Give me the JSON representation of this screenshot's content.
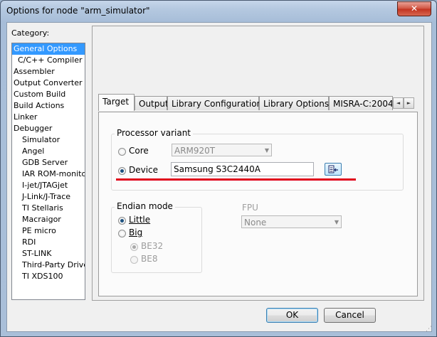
{
  "window": {
    "title": "Options for node \"arm_simulator\"",
    "close_glyph": "✕"
  },
  "category": {
    "label": "Category:",
    "items": [
      {
        "label": "General Options",
        "selected": true,
        "indent": 0
      },
      {
        "label": "C/C++ Compiler",
        "indent": 1
      },
      {
        "label": "Assembler",
        "indent": 0
      },
      {
        "label": "Output Converter",
        "indent": 0
      },
      {
        "label": "Custom Build",
        "indent": 0
      },
      {
        "label": "Build Actions",
        "indent": 0
      },
      {
        "label": "Linker",
        "indent": 0
      },
      {
        "label": "Debugger",
        "indent": 0
      },
      {
        "label": "Simulator",
        "indent": 2
      },
      {
        "label": "Angel",
        "indent": 2
      },
      {
        "label": "GDB Server",
        "indent": 2
      },
      {
        "label": "IAR ROM-monitor",
        "indent": 2
      },
      {
        "label": "I-jet/JTAGjet",
        "indent": 2
      },
      {
        "label": "J-Link/J-Trace",
        "indent": 2
      },
      {
        "label": "TI Stellaris",
        "indent": 2
      },
      {
        "label": "Macraigor",
        "indent": 2
      },
      {
        "label": "PE micro",
        "indent": 2
      },
      {
        "label": "RDI",
        "indent": 2
      },
      {
        "label": "ST-LINK",
        "indent": 2
      },
      {
        "label": "Third-Party Driver",
        "indent": 2
      },
      {
        "label": "TI XDS100",
        "indent": 2
      }
    ]
  },
  "tabs": {
    "items": [
      "Target",
      "Output",
      "Library Configuration",
      "Library Options",
      "MISRA-C:2004"
    ],
    "active": 0,
    "scroll_left": "◄",
    "scroll_right": "►"
  },
  "processor": {
    "group_label": "Processor variant",
    "core_label": "Core",
    "core_value": "ARM920T",
    "device_label": "Device",
    "device_value": "Samsung S3C2440A",
    "selected": "device",
    "highlight_color": "#e0001a"
  },
  "endian": {
    "group_label": "Endian mode",
    "little_label": "Little",
    "big_label": "Big",
    "be32_label": "BE32",
    "be8_label": "BE8",
    "selected": "little"
  },
  "fpu": {
    "label": "FPU",
    "value": "None"
  },
  "buttons": {
    "ok": "OK",
    "cancel": "Cancel"
  }
}
